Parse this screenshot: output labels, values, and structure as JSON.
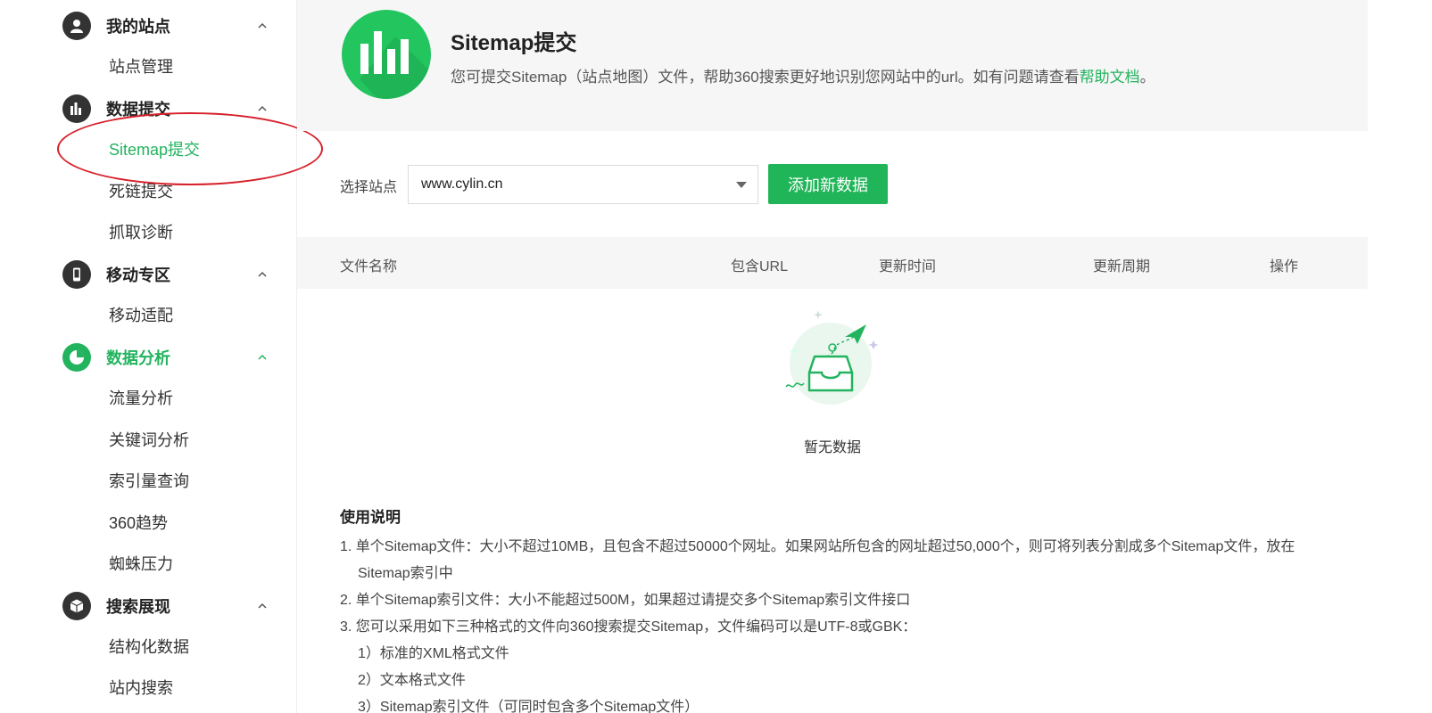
{
  "sidebar": {
    "groups": [
      {
        "title": "我的站点",
        "icon": "user-icon",
        "items": [
          "站点管理"
        ]
      },
      {
        "title": "数据提交",
        "icon": "bar-chart-icon",
        "items": [
          "Sitemap提交",
          "死链提交",
          "抓取诊断"
        ]
      },
      {
        "title": "移动专区",
        "icon": "mobile-icon",
        "items": [
          "移动适配"
        ]
      },
      {
        "title": "数据分析",
        "icon": "pie-chart-icon",
        "items": [
          "流量分析",
          "关键词分析",
          "索引量查询",
          "360趋势",
          "蜘蛛压力"
        ]
      },
      {
        "title": "搜索展现",
        "icon": "cube-icon",
        "items": [
          "结构化数据",
          "站内搜索"
        ]
      }
    ],
    "active_item": "Sitemap提交",
    "active_group": "数据分析"
  },
  "header": {
    "title": "Sitemap提交",
    "desc_prefix": "您可提交Sitemap（站点地图）文件，帮助360搜索更好地识别您网站中的url。如有问题请查看",
    "help_link": "帮助文档",
    "desc_suffix": "。"
  },
  "toolbar": {
    "site_label": "选择站点",
    "site_value": "www.cylin.cn",
    "add_button": "添加新数据"
  },
  "table": {
    "columns": [
      "文件名称",
      "包含URL",
      "更新时间",
      "更新周期",
      "操作"
    ],
    "empty_text": "暂无数据"
  },
  "instructions": {
    "title": "使用说明",
    "lines": [
      "1.  单个Sitemap文件：大小不超过10MB，且包含不超过50000个网址。如果网站所包含的网址超过50,000个，则可将列表分割成多个Sitemap文件，放在",
      "Sitemap索引中",
      "2.  单个Sitemap索引文件：大小不能超过500M，如果超过请提交多个Sitemap索引文件接口",
      "3.  您可以采用如下三种格式的文件向360搜索提交Sitemap，文件编码可以是UTF-8或GBK：",
      "1）标准的XML格式文件",
      "2）文本格式文件",
      "3）Sitemap索引文件（可同时包含多个Sitemap文件）"
    ]
  },
  "colors": {
    "accent": "#22b35e",
    "annotation": "#d6202a"
  }
}
